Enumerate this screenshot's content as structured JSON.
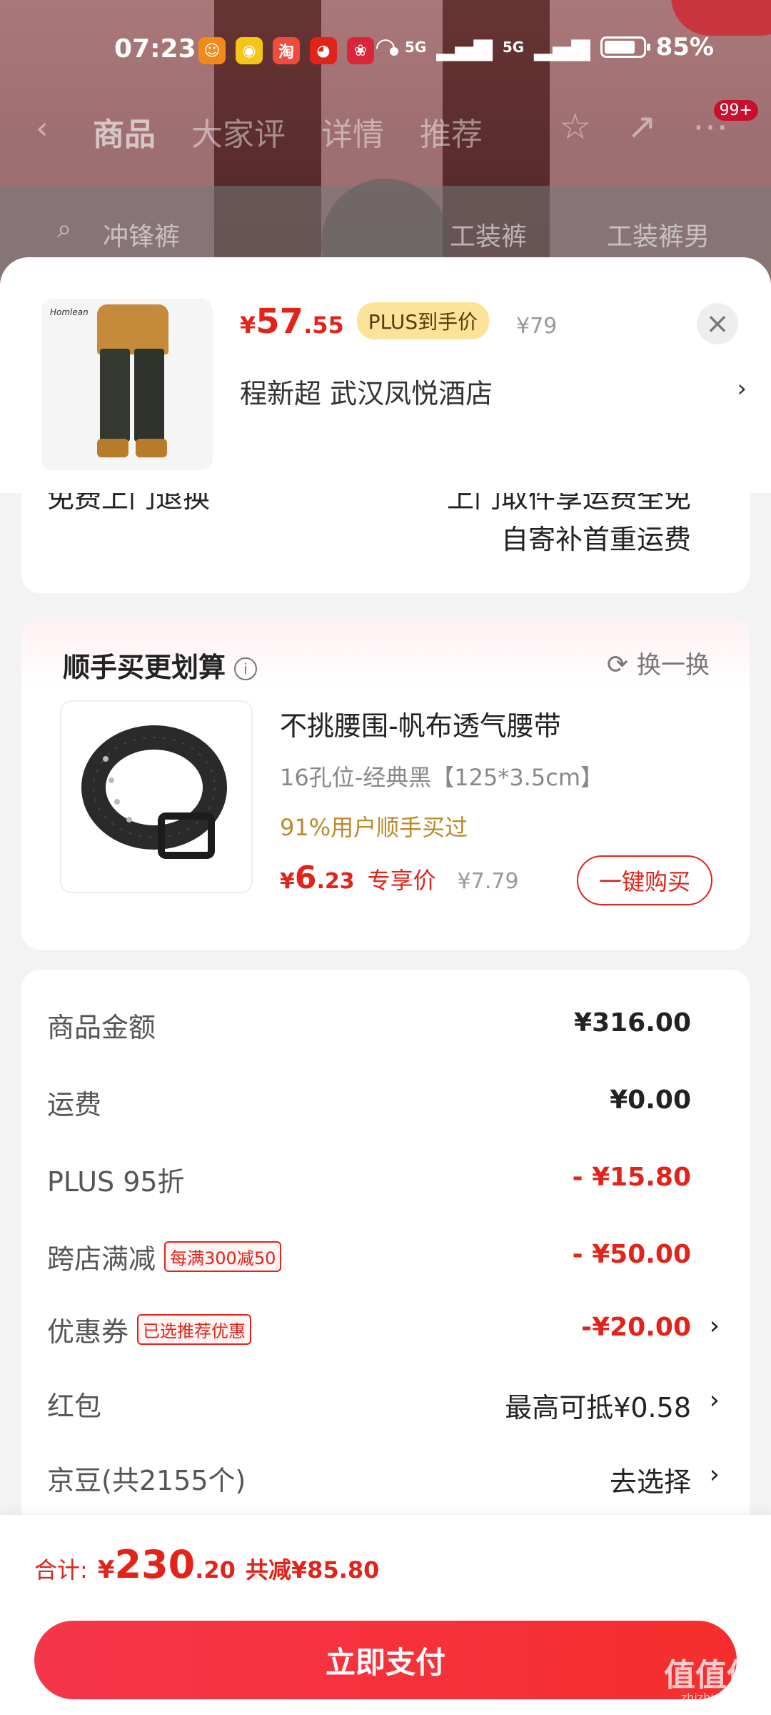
{
  "status_bar": {
    "time": "07:23",
    "battery": "85%",
    "network": "5G",
    "apps": [
      {
        "name": "app-icon-1",
        "color": "#f28a1b",
        "glyph": "☺"
      },
      {
        "name": "weibo-icon",
        "color": "#f5c518",
        "glyph": "◉"
      },
      {
        "name": "taobao-icon",
        "color": "#f04b3b",
        "glyph": "淘"
      },
      {
        "name": "jd-icon",
        "color": "#e2231a",
        "glyph": "◕"
      },
      {
        "name": "app-icon-5",
        "color": "#d9263a",
        "glyph": "❀"
      }
    ]
  },
  "background_page": {
    "tabs": [
      "商品",
      "大家评",
      "详情",
      "推荐"
    ],
    "cart_badge": "99+",
    "search_placeholder": "冲锋裤",
    "keywords": [
      "工装裤",
      "工装裤男"
    ]
  },
  "product": {
    "price_yen": "¥",
    "price_int": "57",
    "price_dec": ".55",
    "plus_label": "PLUS到手价",
    "orig_price": "¥79",
    "address": "程新超  武汉凤悦酒店",
    "brand": "Homlean"
  },
  "service": {
    "left": "免费上门退换",
    "right_line1": "上门取件享运费全免",
    "right_line2": "自寄补首重运费"
  },
  "upsell": {
    "title": "顺手买更划算",
    "refresh_label": "换一换",
    "name": "不挑腰围-帆布透气腰带",
    "spec": "16孔位-经典黑【125*3.5cm】",
    "bought": "91%用户顺手买过",
    "price_yen": "¥",
    "price_int": "6",
    "price_dec": ".23",
    "price_label": "专享价",
    "orig_price": "¥7.79",
    "buy_label": "一键购买"
  },
  "summary": {
    "goods_label": "商品金额",
    "goods_value": "¥316.00",
    "shipping_label": "运费",
    "shipping_value": "¥0.00",
    "plus_label": "PLUS 95折",
    "plus_value": "- ¥15.80",
    "cross_label": "跨店满减",
    "cross_tag": "每满300减50",
    "cross_value": "- ¥50.00",
    "coupon_label": "优惠券",
    "coupon_tag": "已选推荐优惠",
    "coupon_value": "-¥20.00",
    "redpacket_label": "红包",
    "redpacket_value": "最高可抵¥0.58",
    "jingdou_label": "京豆(共2155个)",
    "jingdou_value": "去选择"
  },
  "footer": {
    "total_label": "合计:",
    "total_yen": "¥",
    "total_int": "230",
    "total_dec": ".20",
    "saved": "共减¥85.80",
    "pay_label": "立即支付",
    "watermark": "值值值",
    "watermark_sub": "zhizhizhi.com"
  },
  "colors": {
    "accent": "#e2231a",
    "pay_button": "#f5364a",
    "plus_tag_bg": "#fbe39a",
    "bought_text": "#b98a2a"
  }
}
